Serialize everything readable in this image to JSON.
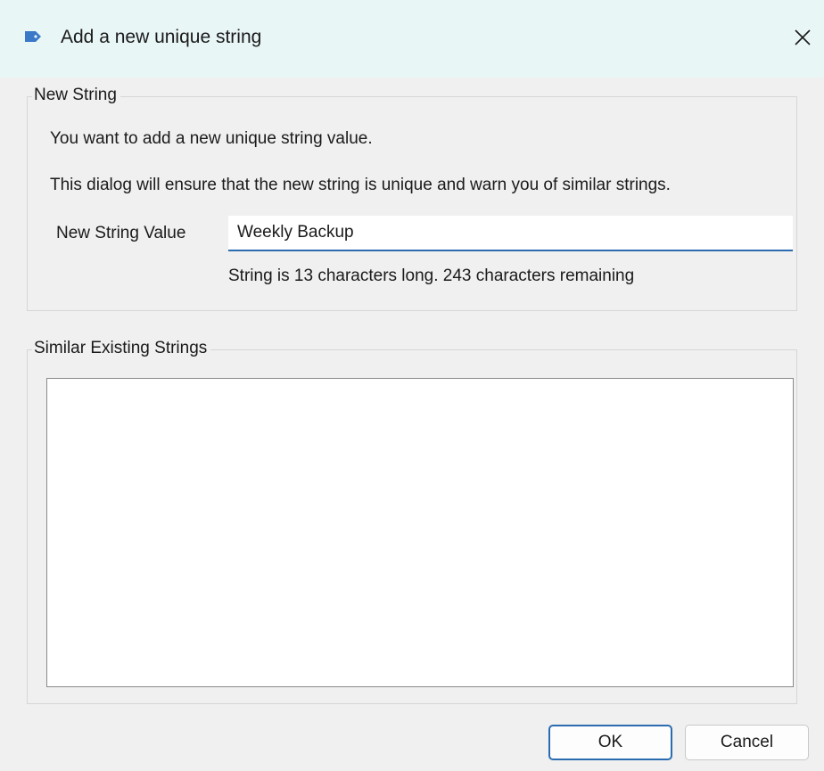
{
  "window": {
    "title": "Add a new unique string",
    "close_glyph": "✕",
    "accent_color": "#2b6cb0",
    "titlebar_color": "#e9f6f6"
  },
  "new_string_group": {
    "legend": "New String",
    "intro_text": "You want to add a new unique string value.",
    "description_text": "This dialog will ensure that the new string is unique and warn you of similar strings.",
    "field_label": "New String Value",
    "field_value": "Weekly Backup",
    "status_text": "String is 13 characters long. 243 characters remaining"
  },
  "similar_group": {
    "legend": "Similar Existing Strings",
    "items": []
  },
  "buttons": {
    "ok_label": "OK",
    "cancel_label": "Cancel"
  },
  "icons": {
    "title_icon": "tag-icon",
    "close_icon": "close-icon"
  }
}
